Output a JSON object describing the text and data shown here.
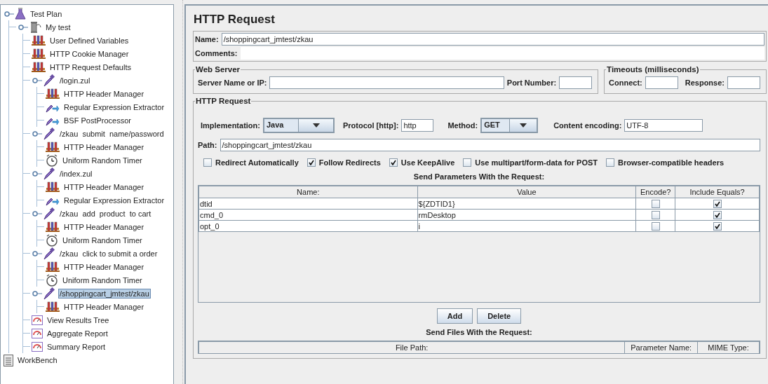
{
  "tree": [
    {
      "label": "Test Plan",
      "kind": "plan",
      "expanded": true,
      "selected": false,
      "children": [
        {
          "label": "My test",
          "kind": "threads",
          "expanded": true,
          "selected": false,
          "children": [
            {
              "label": "User Defined Variables",
              "kind": "config",
              "selected": false
            },
            {
              "label": "HTTP Cookie Manager",
              "kind": "config",
              "selected": false
            },
            {
              "label": "HTTP Request Defaults",
              "kind": "config",
              "selected": false
            },
            {
              "label": "/login.zul",
              "kind": "sampler",
              "expanded": true,
              "selected": false,
              "children": [
                {
                  "label": "HTTP Header Manager",
                  "kind": "config",
                  "selected": false
                },
                {
                  "label": "Regular Expression Extractor",
                  "kind": "post",
                  "selected": false
                },
                {
                  "label": "BSF PostProcessor",
                  "kind": "post",
                  "selected": false
                }
              ]
            },
            {
              "label": "/zkau  submit  name/password",
              "kind": "sampler",
              "expanded": true,
              "selected": false,
              "children": [
                {
                  "label": "HTTP Header Manager",
                  "kind": "config",
                  "selected": false
                },
                {
                  "label": "Uniform Random Timer",
                  "kind": "timer",
                  "selected": false
                }
              ]
            },
            {
              "label": "/index.zul",
              "kind": "sampler",
              "expanded": true,
              "selected": false,
              "children": [
                {
                  "label": "HTTP Header Manager",
                  "kind": "config",
                  "selected": false
                },
                {
                  "label": "Regular Expression Extractor",
                  "kind": "post",
                  "selected": false
                }
              ]
            },
            {
              "label": "/zkau  add  product  to cart",
              "kind": "sampler",
              "expanded": true,
              "selected": false,
              "children": [
                {
                  "label": "HTTP Header Manager",
                  "kind": "config",
                  "selected": false
                },
                {
                  "label": "Uniform Random Timer",
                  "kind": "timer",
                  "selected": false
                }
              ]
            },
            {
              "label": "/zkau  click to submit a order",
              "kind": "sampler",
              "expanded": true,
              "selected": false,
              "children": [
                {
                  "label": "HTTP Header Manager",
                  "kind": "config",
                  "selected": false
                },
                {
                  "label": "Uniform Random Timer",
                  "kind": "timer",
                  "selected": false
                }
              ]
            },
            {
              "label": "/shoppingcart_jmtest/zkau",
              "kind": "sampler",
              "expanded": true,
              "selected": true,
              "children": [
                {
                  "label": "HTTP Header Manager",
                  "kind": "config",
                  "selected": false
                }
              ]
            },
            {
              "label": "View Results Tree",
              "kind": "listener",
              "selected": false
            },
            {
              "label": "Aggregate Report",
              "kind": "listener",
              "selected": false
            },
            {
              "label": "Summary Report",
              "kind": "listener",
              "selected": false
            }
          ]
        }
      ]
    },
    {
      "label": "WorkBench",
      "kind": "workbench",
      "selected": false
    }
  ],
  "editor": {
    "title": "HTTP Request",
    "name_label": "Name:",
    "name_value": "/shoppingcart_jmtest/zkau",
    "comments_label": "Comments:",
    "web_server": {
      "legend": "Web Server",
      "server_label": "Server Name or IP:",
      "port_label": "Port Number:"
    },
    "timeouts": {
      "legend": "Timeouts (milliseconds)",
      "connect_label": "Connect:",
      "response_label": "Response:"
    },
    "http_request": {
      "legend": "HTTP Request",
      "implementation_label": "Implementation:",
      "implementation_value": "Java",
      "protocol_label": "Protocol [http]:",
      "protocol_value": "http",
      "method_label": "Method:",
      "method_value": "GET",
      "encoding_label": "Content encoding:",
      "encoding_value": "UTF-8",
      "path_label": "Path:",
      "path_value": "/shoppingcart_jmtest/zkau",
      "options": [
        {
          "label": "Redirect Automatically",
          "checked": false
        },
        {
          "label": "Follow Redirects",
          "checked": true
        },
        {
          "label": "Use KeepAlive",
          "checked": true
        },
        {
          "label": "Use multipart/form-data for POST",
          "checked": false
        },
        {
          "label": "Browser-compatible headers",
          "checked": false
        }
      ],
      "params_title": "Send Parameters With the Request:",
      "params_columns": [
        "Name:",
        "Value",
        "Encode?",
        "Include Equals?"
      ],
      "params_rows": [
        {
          "name": "dtid",
          "value": "${ZDTID1}",
          "encode": false,
          "include_equals": true
        },
        {
          "name": "cmd_0",
          "value": "rmDesktop",
          "encode": false,
          "include_equals": true
        },
        {
          "name": "opt_0",
          "value": "i",
          "encode": false,
          "include_equals": true
        }
      ],
      "buttons": [
        "Add",
        "Delete"
      ],
      "files_title": "Send Files With the Request:",
      "files_columns": [
        "File Path:",
        "Parameter Name:",
        "MIME Type:"
      ]
    }
  }
}
